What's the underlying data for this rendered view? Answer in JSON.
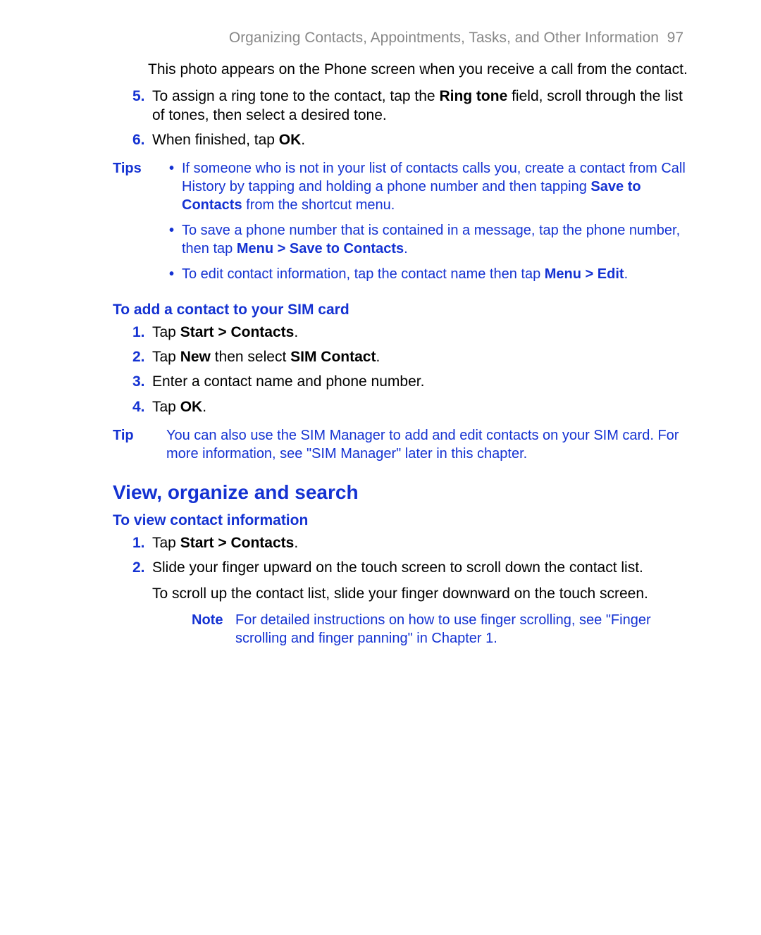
{
  "header": {
    "title": "Organizing Contacts, Appointments, Tasks, and Other Information",
    "page": "97"
  },
  "intro": "This photo appears on the Phone screen when you receive a call from the contact.",
  "steps_a": [
    {
      "n": "5.",
      "pre": "To assign a ring tone to the contact, tap the ",
      "bold": "Ring tone",
      "post": " field, scroll through the list of tones, then select a desired tone."
    },
    {
      "n": "6.",
      "pre": "When finished, tap ",
      "bold": "OK",
      "post": "."
    }
  ],
  "tips": {
    "label": "Tips",
    "items": [
      {
        "pre": "If someone who is not in your list of contacts calls you, create a contact from Call History by tapping and holding a phone number and then tapping ",
        "bold": "Save to Contacts",
        "post": " from the shortcut menu."
      },
      {
        "pre": "To save a phone number that is contained in a message, tap the phone number, then tap ",
        "bold": "Menu > Save to Contacts",
        "post": "."
      },
      {
        "pre": "To edit contact information, tap the contact name then tap ",
        "bold": "Menu > Edit",
        "post": "."
      }
    ]
  },
  "sim_heading": "To add a contact to your SIM card",
  "sim_steps": [
    {
      "n": "1.",
      "pre": "Tap ",
      "bold": "Start > Contacts",
      "post": "."
    },
    {
      "n": "2.",
      "pre": "Tap ",
      "bold": "New",
      "mid": " then select ",
      "bold2": "SIM Contact",
      "post": "."
    },
    {
      "n": "3.",
      "pre": "Enter a contact name and phone number.",
      "bold": "",
      "post": ""
    },
    {
      "n": "4.",
      "pre": "Tap ",
      "bold": "OK",
      "post": "."
    }
  ],
  "tip_single": {
    "label": "Tip",
    "text": "You can also use the SIM Manager to add and edit contacts on your SIM card. For more information, see \"SIM Manager\" later in this chapter."
  },
  "section2": "View, organize and search",
  "view_heading": "To view contact information",
  "view_steps": [
    {
      "n": "1.",
      "pre": "Tap ",
      "bold": "Start > Contacts",
      "post": "."
    },
    {
      "n": "2.",
      "pre": "Slide your finger upward on the touch screen to scroll down the contact list.",
      "bold": "",
      "post": "",
      "extra": "To scroll up the contact list, slide your finger downward on the touch screen."
    }
  ],
  "note": {
    "label": "Note",
    "text": "For detailed instructions on how to use finger scrolling, see \"Finger scrolling and finger panning\" in Chapter 1."
  }
}
